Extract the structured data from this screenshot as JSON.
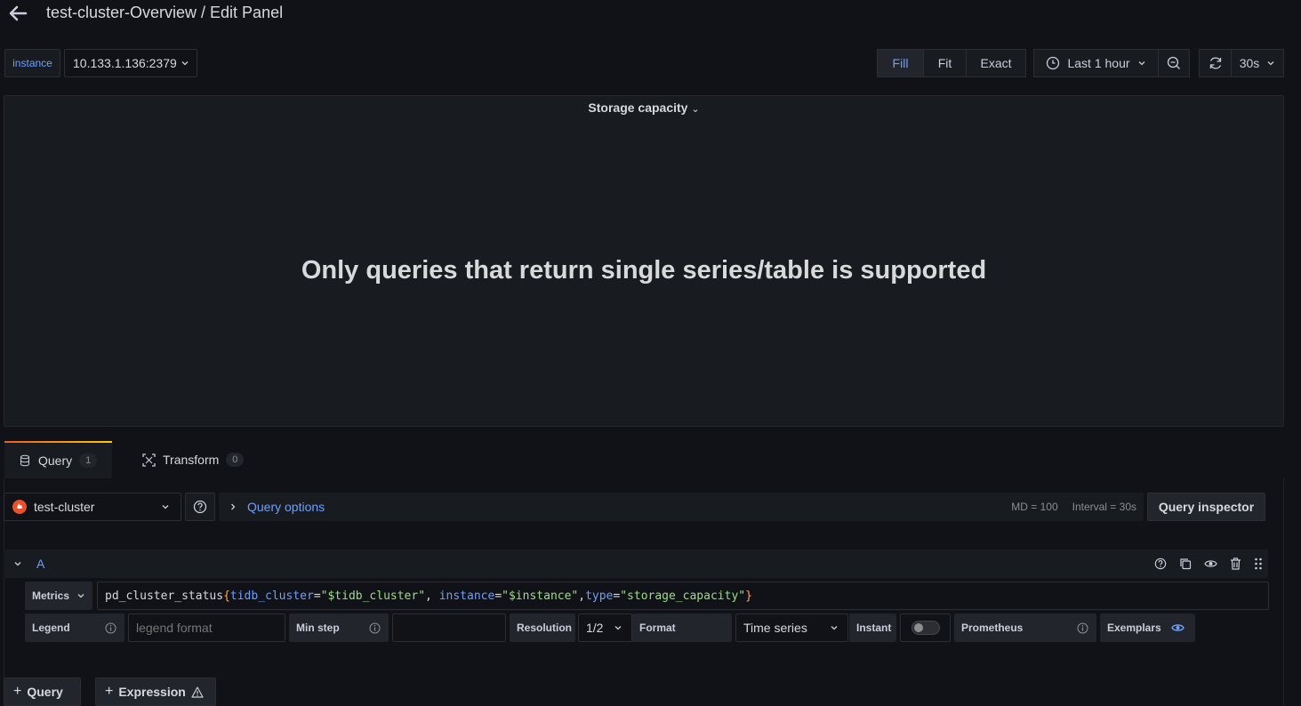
{
  "header": {
    "title": "test-cluster-Overview / Edit Panel"
  },
  "variables": {
    "label": "instance",
    "value": "10.133.1.136:2379"
  },
  "view_mode": {
    "options": [
      "Fill",
      "Fit",
      "Exact"
    ],
    "selected": "Fill"
  },
  "time_picker": {
    "range": "Last 1 hour"
  },
  "refresh": {
    "interval": "30s"
  },
  "panel": {
    "title": "Storage capacity",
    "message": "Only queries that return single series/table is supported"
  },
  "tabs": [
    {
      "label": "Query",
      "count": "1"
    },
    {
      "label": "Transform",
      "count": "0"
    }
  ],
  "datasource": {
    "name": "test-cluster"
  },
  "query_options": {
    "label": "Query options",
    "md": "MD = 100",
    "interval": "Interval = 30s"
  },
  "query_inspector": {
    "label": "Query inspector"
  },
  "query_a": {
    "ref": "A",
    "metrics_label": "Metrics",
    "expr": {
      "metric": "pd_cluster_status",
      "open": "{",
      "k1": "tidb_cluster",
      "eq1": "=",
      "v1": "\"$tidb_cluster\"",
      "sep1": ", ",
      "k2": "instance",
      "eq2": "=",
      "v2": "\"$instance\"",
      "sep2": ",",
      "k3": "type",
      "eq3": "=",
      "v3": "\"storage_capacity\"",
      "close": "}"
    },
    "legend_label": "Legend",
    "legend_placeholder": "legend format",
    "min_step_label": "Min step",
    "resolution_label": "Resolution",
    "resolution_value": "1/2",
    "format_label": "Format",
    "format_value": "Time series",
    "instant_label": "Instant",
    "instant_on": false,
    "prometheus_label": "Prometheus",
    "exemplars_label": "Exemplars"
  },
  "add_buttons": {
    "query": "Query",
    "expression": "Expression"
  },
  "colors": {
    "accent_blue": "#6e9fff",
    "background": "#111217",
    "panel": "#181b1f",
    "code_key": "#6e9fff",
    "code_value": "#9ade84",
    "code_brace": "#ffa657",
    "prometheus_orange": "#e6522c"
  }
}
